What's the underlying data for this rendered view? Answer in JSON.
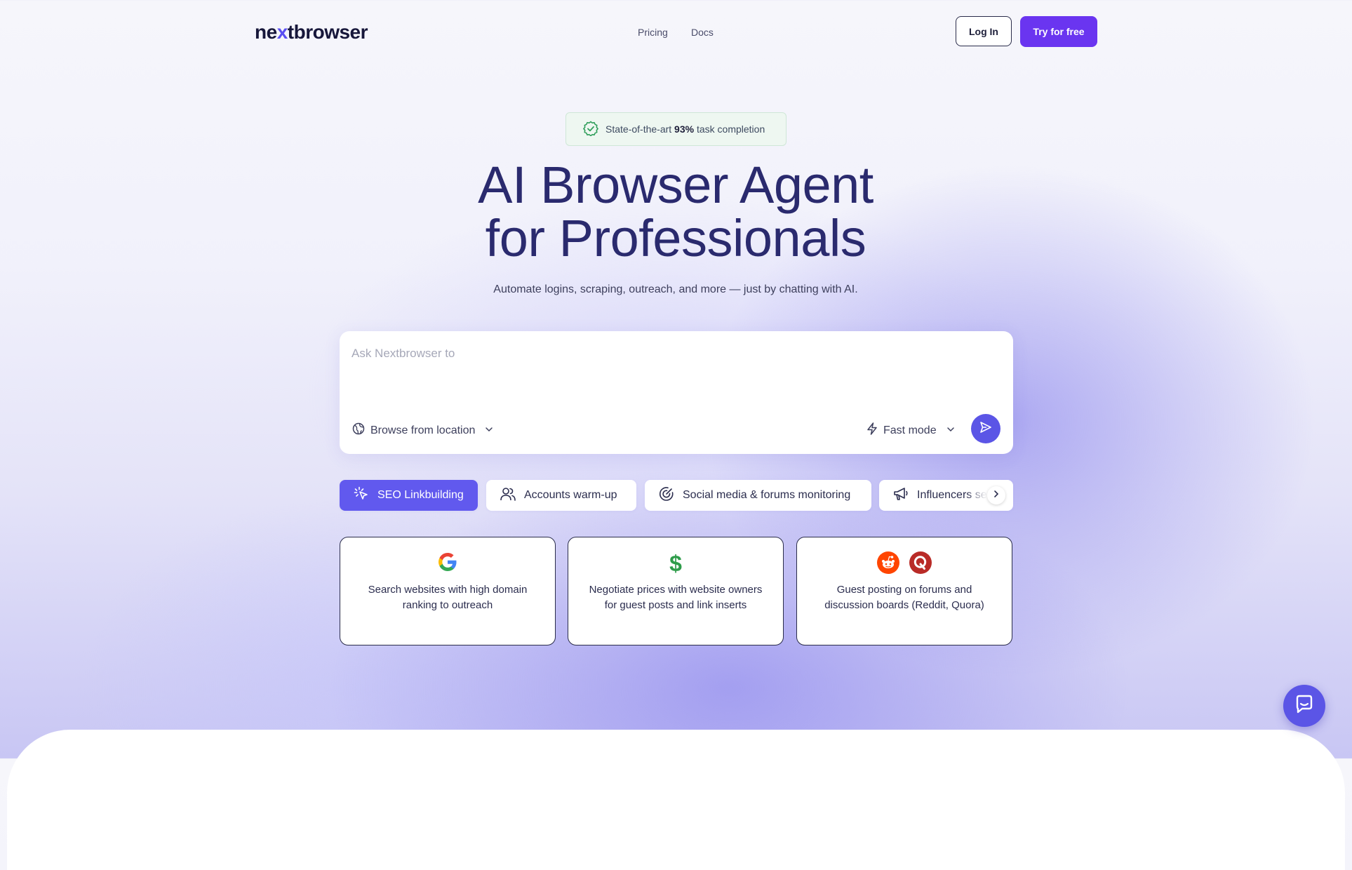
{
  "header": {
    "logo_pre": "ne",
    "logo_x": "x",
    "logo_post": "tbrowser",
    "nav": [
      "Pricing",
      "Docs"
    ],
    "login_label": "Log In",
    "try_label": "Try for free"
  },
  "badge": {
    "text_pre": "State-of-the-art ",
    "text_bold": "93%",
    "text_post": " task completion"
  },
  "hero": {
    "title_line1": "AI Browser Agent",
    "title_line2": "for Professionals",
    "subtitle": "Automate logins, scraping, outreach, and more — just by chatting with AI."
  },
  "prompt": {
    "placeholder": "Ask Nextbrowser to",
    "location_label": "Browse from location",
    "mode_label": "Fast mode"
  },
  "tabs": [
    {
      "label": "SEO Linkbuilding",
      "active": true
    },
    {
      "label": "Accounts warm-up"
    },
    {
      "label": "Social media & forums monitoring"
    },
    {
      "label": "Influencers se"
    }
  ],
  "cards": [
    {
      "text": "Search websites with high domain ranking to outreach",
      "icons": [
        "google-icon"
      ]
    },
    {
      "text": "Negotiate prices with website owners for guest posts and link inserts",
      "icons": [
        "dollar-icon"
      ]
    },
    {
      "text": "Guest posting on forums and discussion boards (Reddit, Quora)",
      "icons": [
        "reddit-icon",
        "quora-icon"
      ]
    }
  ],
  "colors": {
    "accent": "#5b55e6",
    "try_button": "#6a35f0",
    "badge_bg": "#eef7f1",
    "badge_check": "#2f9e5a"
  }
}
